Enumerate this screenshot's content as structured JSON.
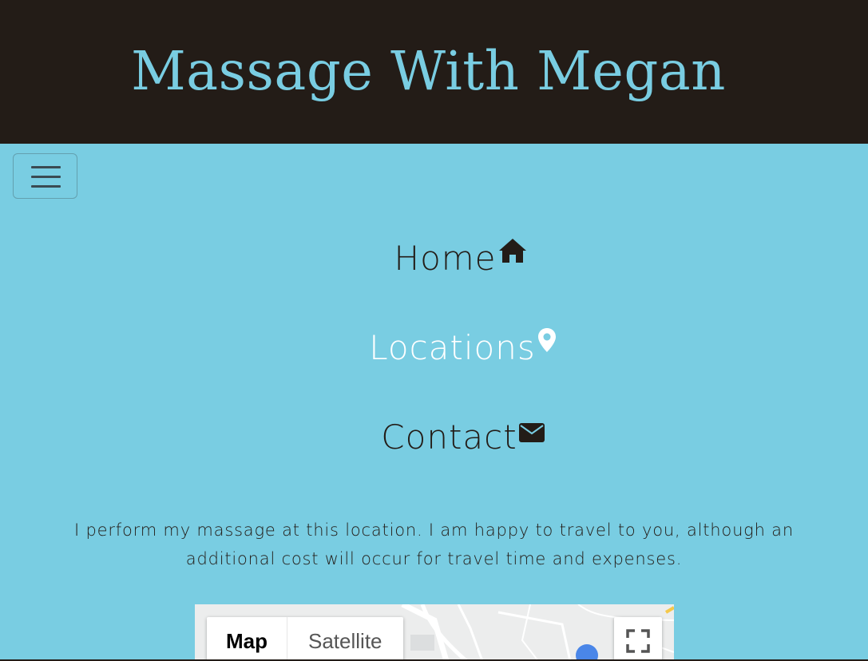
{
  "header": {
    "title": "Massage With Megan"
  },
  "navbar": {
    "toggler_icon": "hamburger-menu-icon",
    "links": [
      {
        "label": "Home",
        "icon": "home-icon"
      },
      {
        "label": "Locations",
        "icon": "map-pin-icon",
        "active": true
      },
      {
        "label": "Contact",
        "icon": "envelope-icon"
      }
    ]
  },
  "content": {
    "intro": "I perform my massage at this location. I am happy to travel to you, although an additional cost will occur for travel time and expenses."
  },
  "map": {
    "type_buttons": [
      {
        "label": "Map",
        "selected": true
      },
      {
        "label": "Satellite",
        "selected": false
      }
    ],
    "fullscreen_icon": "fullscreen-icon"
  },
  "colors": {
    "header_bg": "#231c17",
    "page_bg": "#79cde2",
    "title_color": "#79cde2",
    "active_link": "#ffffff",
    "text": "#231c17"
  }
}
